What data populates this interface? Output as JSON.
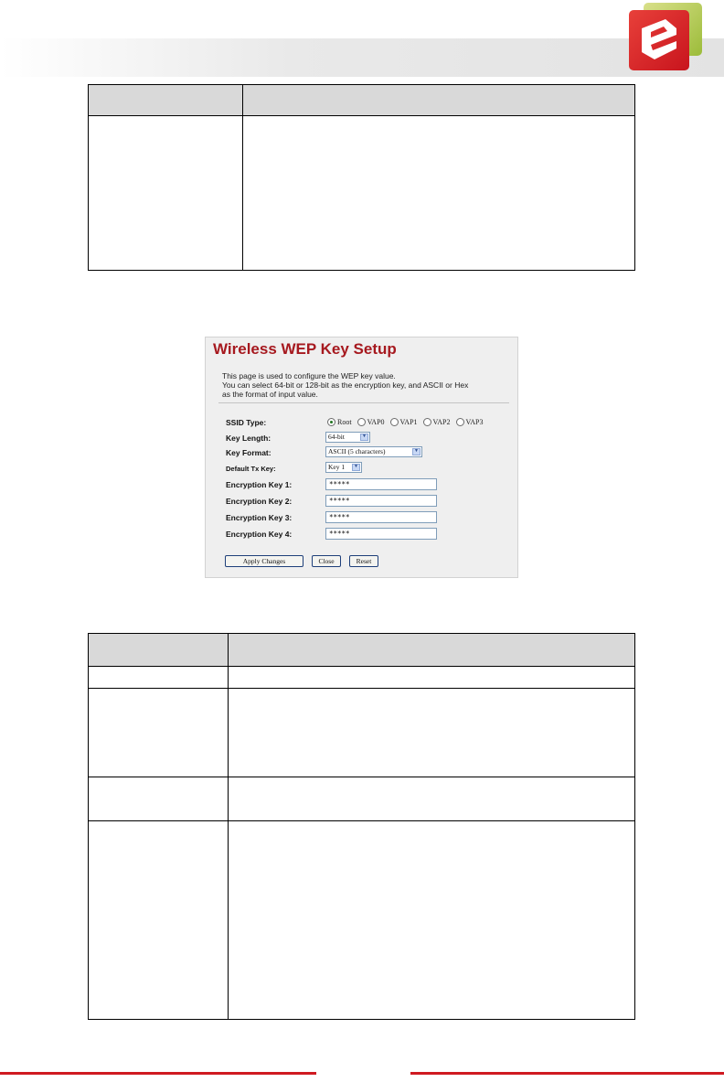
{
  "screenshot": {
    "title": "Wireless WEP Key Setup",
    "description_lines": [
      "This page is used to configure the WEP key value.",
      "You can select 64-bit or 128-bit as the encryption key, and ASCII or Hex",
      "as the format of input value."
    ],
    "form": {
      "ssid_type_label": "SSID Type:",
      "ssid_options": [
        "Root",
        "VAP0",
        "VAP1",
        "VAP2",
        "VAP3"
      ],
      "ssid_selected": "Root",
      "key_length_label": "Key Length:",
      "key_length_value": "64-bit",
      "key_format_label": "Key Format:",
      "key_format_value": "ASCII (5 characters)",
      "default_tx_key_label": "Default Tx Key:",
      "default_tx_key_value": "Key 1",
      "encryption_keys": [
        {
          "label": "Encryption Key 1:",
          "value": "*****"
        },
        {
          "label": "Encryption Key 2:",
          "value": "*****"
        },
        {
          "label": "Encryption Key 3:",
          "value": "*****"
        },
        {
          "label": "Encryption Key 4:",
          "value": "*****"
        }
      ]
    },
    "buttons": {
      "apply": "Apply Changes",
      "close": "Close",
      "reset": "Reset"
    }
  },
  "colors": {
    "title_red": "#a6191f",
    "footer_red": "#cf1a21",
    "table_header_gray": "#d9d9d9",
    "panel_bg": "#efefef"
  },
  "icons": {
    "logo": "brand-logo-icon",
    "select_arrow": "chevron-down-icon"
  }
}
